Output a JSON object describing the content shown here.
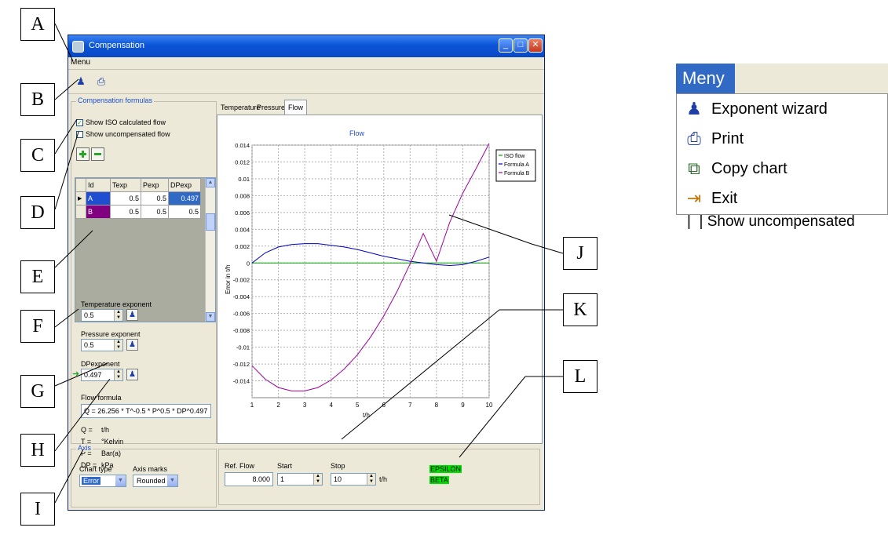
{
  "window": {
    "title": "Compensation",
    "menu_label": "Menu"
  },
  "toolbar": {
    "exponent_wizard_icon": "exponent-wizard-icon",
    "print_icon": "print-icon"
  },
  "formulas": {
    "group_label": "Compensation formulas",
    "show_iso_label": "Show ISO calculated flow",
    "show_iso_checked": true,
    "show_uncomp_label": "Show uncompensated flow",
    "show_uncomp_checked": false,
    "grid_headers": [
      "Id",
      "Texp",
      "Pexp",
      "DPexp"
    ],
    "grid_rows": [
      {
        "id": "A",
        "texp": "0.5",
        "pexp": "0.5",
        "dpexp": "0.497",
        "color": "#1f4ed0"
      },
      {
        "id": "B",
        "texp": "0.5",
        "pexp": "0.5",
        "dpexp": "0.5",
        "color": "#800080"
      }
    ],
    "temp_label": "Temperature exponent",
    "temp_value": "0.5",
    "pressure_label": "Pressure exponent",
    "pressure_value": "0.5",
    "dp_label": "DPexponent",
    "dp_value": "0.497",
    "flow_formula_label": "Flow formula",
    "flow_formula_value": "Q = 26.256 * T^-0.5 * P^0.5 * DP^0.497",
    "units": [
      {
        "sym": "Q =",
        "unit": "t/h"
      },
      {
        "sym": "T =",
        "unit": "°Kelvin"
      },
      {
        "sym": "P =",
        "unit": "Bar(a)"
      },
      {
        "sym": "DP =",
        "unit": "kPa"
      }
    ]
  },
  "axis": {
    "group_label": "Axis",
    "chart_type_label": "Chart type",
    "chart_type_value": "Error",
    "axis_marks_label": "Axis marks",
    "axis_marks_value": "Rounded"
  },
  "tabs": [
    "Temperature",
    "Pressure",
    "Flow"
  ],
  "active_tab": "Flow",
  "bottom": {
    "ref_flow_label": "Ref. Flow",
    "ref_flow_value": "8.000",
    "start_label": "Start",
    "start_value": "1",
    "stop_label": "Stop",
    "stop_value": "10",
    "unit": "t/h",
    "badge1": "EPSILON",
    "badge2": "BETA",
    "badge_color": "#00e000"
  },
  "chart_data": {
    "type": "line",
    "title": "Flow",
    "xlabel": "t/h",
    "ylabel": "Error in t/h",
    "xlim": [
      1,
      10
    ],
    "ylim": [
      -0.016,
      0.014
    ],
    "x_ticks": [
      "1",
      "2",
      "3",
      "4",
      "5",
      "6",
      "7",
      "8",
      "9",
      "10"
    ],
    "y_ticks": [
      "0.014",
      "0.012",
      "0.01",
      "0.008",
      "0.006",
      "0.004",
      "0.002",
      "0",
      "-0.002",
      "-0.004",
      "-0.006",
      "-0.008",
      "-0.01",
      "-0.012",
      "-0.014"
    ],
    "grid": true,
    "legend_position": "top-right",
    "series": [
      {
        "name": "ISO flow",
        "color": "#00a000",
        "x": [
          1,
          2,
          3,
          4,
          5,
          6,
          7,
          8,
          9,
          10
        ],
        "y": [
          0,
          0,
          0,
          0,
          0,
          0,
          0,
          0,
          0,
          0
        ]
      },
      {
        "name": "Formula A",
        "color": "#0000c0",
        "x": [
          1,
          1.5,
          2,
          2.5,
          3,
          3.5,
          4,
          4.5,
          5,
          5.5,
          6,
          6.5,
          7,
          7.5,
          8,
          8.5,
          9,
          9.5,
          10
        ],
        "y": [
          0.0,
          0.0012,
          0.0019,
          0.0022,
          0.0023,
          0.0023,
          0.0021,
          0.0019,
          0.0016,
          0.0012,
          0.0008,
          0.0005,
          0.0002,
          0.0,
          -0.0002,
          -0.0003,
          -0.0002,
          0.0002,
          0.0007
        ]
      },
      {
        "name": "Formula B",
        "color": "#a000a0",
        "x": [
          1,
          1.5,
          2,
          2.5,
          3,
          3.5,
          4,
          4.5,
          5,
          5.5,
          6,
          6.5,
          7,
          7.5,
          8,
          8.5,
          9,
          9.5,
          10
        ],
        "y": [
          -0.0122,
          -0.0138,
          -0.0148,
          -0.0152,
          -0.0152,
          -0.0148,
          -0.0139,
          -0.0126,
          -0.0109,
          -0.0088,
          -0.0063,
          -0.0034,
          -0.0001,
          0.0035,
          0.0002,
          0.0048,
          0.0083,
          0.0112,
          0.0142
        ]
      }
    ]
  },
  "callouts": [
    "A",
    "B",
    "C",
    "D",
    "E",
    "F",
    "G",
    "H",
    "I",
    "J",
    "K",
    "L"
  ],
  "side_menu": {
    "title": "Meny",
    "items": [
      {
        "label": "Exponent wizard",
        "icon": "exponent-wizard-icon"
      },
      {
        "label": "Print",
        "icon": "print-icon"
      },
      {
        "label": "Copy chart",
        "icon": "copy-chart-icon"
      },
      {
        "label": "Exit",
        "icon": "exit-icon"
      }
    ],
    "cut_text": "Show uncompensated"
  }
}
